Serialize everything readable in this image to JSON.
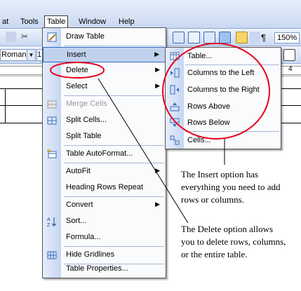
{
  "menubar": {
    "items": [
      "at",
      "Tools",
      "Table",
      "Window",
      "Help"
    ]
  },
  "toolbar": {
    "zoom": "150%",
    "pilcrow": "¶"
  },
  "fontrow": {
    "font_name": "Roman",
    "font_size": "1"
  },
  "ruler": {
    "mark": "4"
  },
  "table_menu": {
    "items": [
      {
        "label": "Draw Table",
        "icon": "pencil-icon"
      },
      {
        "label": "Insert",
        "submenu": true,
        "highlighted": true
      },
      {
        "label": "Delete",
        "submenu": true
      },
      {
        "label": "Select",
        "submenu": true
      },
      {
        "label": "Merge Cells",
        "disabled": true,
        "icon": "merge-cells-icon"
      },
      {
        "label": "Split Cells...",
        "icon": "split-cells-icon"
      },
      {
        "label": "Split Table"
      },
      {
        "label": "Table AutoFormat...",
        "icon": "autoformat-icon"
      },
      {
        "label": "AutoFit",
        "submenu": true
      },
      {
        "label": "Heading Rows Repeat"
      },
      {
        "label": "Convert",
        "submenu": true
      },
      {
        "label": "Sort...",
        "icon": "sort-az-icon"
      },
      {
        "label": "Formula..."
      },
      {
        "label": "Hide Gridlines",
        "icon": "gridlines-icon"
      },
      {
        "label": "Table Properties..."
      }
    ]
  },
  "insert_submenu": {
    "items": [
      {
        "label": "Table...",
        "icon": "table-icon"
      },
      {
        "label": "Columns to the Left",
        "icon": "columns-left-icon"
      },
      {
        "label": "Columns to the Right",
        "icon": "columns-right-icon"
      },
      {
        "label": "Rows Above",
        "icon": "rows-above-icon"
      },
      {
        "label": "Rows Below",
        "icon": "rows-below-icon"
      },
      {
        "label": "Cells...",
        "icon": "cells-icon"
      }
    ]
  },
  "annotations": {
    "insert_note": "The Insert option has everything you need to add rows or columns.",
    "delete_note": "The Delete option allows you to delete rows, columns, or the entire table."
  },
  "colors": {
    "highlight_bg": "#c1d2ee",
    "highlight_border": "#316ac5",
    "annotation_red": "#e8001c"
  }
}
